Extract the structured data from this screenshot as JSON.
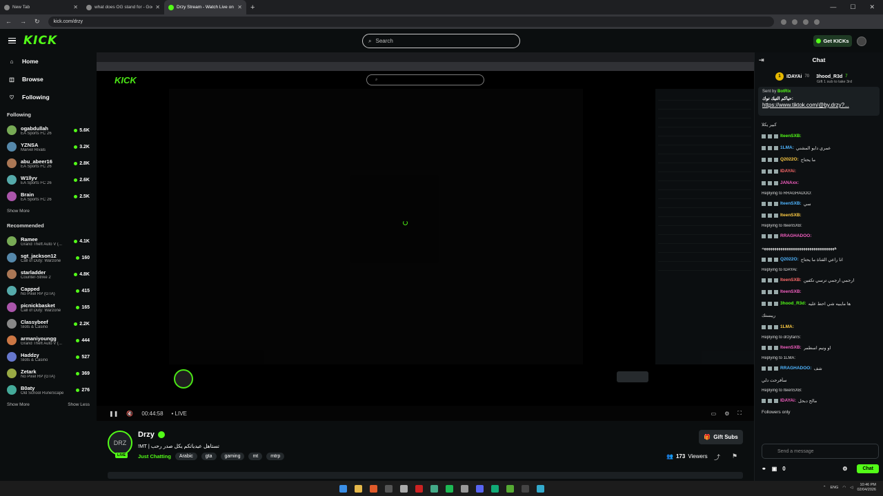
{
  "tabs": [
    {
      "title": "New Tab",
      "active": false
    },
    {
      "title": "what does OG stand for - Goog",
      "active": false
    },
    {
      "title": "Drzy Stream - Watch Live on Ki",
      "active": true
    }
  ],
  "address": {
    "url": "kick.com/drzy"
  },
  "header": {
    "logo": "KICK",
    "search_placeholder": "Search",
    "get_kicks": "Get KICKs"
  },
  "sidebar": {
    "nav": [
      {
        "label": "Home",
        "icon": "home-icon"
      },
      {
        "label": "Browse",
        "icon": "browse-icon"
      },
      {
        "label": "Following",
        "icon": "heart-icon"
      }
    ],
    "following_title": "Following",
    "following": [
      {
        "name": "ogabdullah",
        "game": "EA Sports FC 26",
        "viewers": "5.6K"
      },
      {
        "name": "YZNSA",
        "game": "Marvel Rivals",
        "viewers": "3.2K"
      },
      {
        "name": "abu_abeer16",
        "game": "EA Sports FC 26",
        "viewers": "2.8K"
      },
      {
        "name": "W1llyv",
        "game": "EA Sports FC 26",
        "viewers": "2.6K"
      },
      {
        "name": "Brain",
        "game": "EA Sports FC 26",
        "viewers": "2.5K"
      }
    ],
    "show_more_1": "Show More",
    "recommended_title": "Recommended",
    "recommended": [
      {
        "name": "Ramee",
        "game": "Grand Theft Auto V (...",
        "viewers": "4.1K"
      },
      {
        "name": "sgt_jackson12",
        "game": "Call of Duty: Warzone",
        "viewers": "160"
      },
      {
        "name": "starladder",
        "game": "Counter-Strike 2",
        "viewers": "4.8K"
      },
      {
        "name": "Capped",
        "game": "No Pixel RP (GTA)",
        "viewers": "415"
      },
      {
        "name": "picnickbasket",
        "game": "Call of Duty: Warzone",
        "viewers": "165"
      },
      {
        "name": "Classybeef",
        "game": "Slots & Casino",
        "viewers": "2.2K"
      },
      {
        "name": "armaniyoungg",
        "game": "Grand Theft Auto V (...",
        "viewers": "444"
      },
      {
        "name": "Haddzy",
        "game": "Slots & Casino",
        "viewers": "527"
      },
      {
        "name": "Zetark",
        "game": "No Pixel RP (GTA)",
        "viewers": "369"
      },
      {
        "name": "B0aty",
        "game": "Old School RuneScape",
        "viewers": "276"
      }
    ],
    "show_more_2": "Show More",
    "show_less": "Show Less"
  },
  "player": {
    "time": "00:44:58",
    "live": "LIVE"
  },
  "stream": {
    "name": "Drzy",
    "avatar_text": "DRZ",
    "live_badge": "LIVE",
    "title": "!MT | تستاهل عيدياتكم يكل صدر رحب",
    "category": "Just Chatting",
    "tags": [
      "Arabic",
      "gta",
      "gaming",
      "mt",
      "mtrp"
    ],
    "gift_subs": "Gift Subs",
    "viewers": "173",
    "viewers_label": "Viewers"
  },
  "chat": {
    "title": "Chat",
    "gifter": {
      "rank": "1",
      "name1": "IDAYAi",
      "count1": "70",
      "name2": "3hood_R3d",
      "count2": "7",
      "sub": "Gift 1 sub to take 3rd"
    },
    "pinned": {
      "sent_by": "Sent by",
      "bot": "BotRix",
      "msg": "حياكم التيك توك:",
      "link": "https://www.tiktok.com/@by.drzy?..."
    },
    "messages": [
      {
        "type": "msg",
        "user": "",
        "text": "كبير يكلا"
      },
      {
        "type": "msg",
        "user": "IteenSXB:",
        "text": ""
      },
      {
        "type": "msg",
        "user": "1LMA:",
        "text": "عمري دايو المشني"
      },
      {
        "type": "msg",
        "user": "Q2022O:",
        "text": "ما يحتاج"
      },
      {
        "type": "msg",
        "user": "IDAYAi:",
        "text": ""
      },
      {
        "type": "msg",
        "user": "JANAxx:",
        "text": ""
      },
      {
        "type": "reply",
        "user": "",
        "text": "Replying to RRAGHADOO:"
      },
      {
        "type": "msg",
        "user": "IteenSXB:",
        "text": "سي"
      },
      {
        "type": "msg",
        "user": "IteenSXB:",
        "text": ""
      },
      {
        "type": "reply",
        "user": "",
        "text": "Replying to IteenSXB:"
      },
      {
        "type": "msg",
        "user": "RRAGHADOO:",
        "text": ""
      },
      {
        "type": "msg",
        "user": "",
        "text": "هههههههههههههههههههههههههههههههههههه"
      },
      {
        "type": "msg",
        "user": "Q2022O:",
        "text": "انا راعي القناة ما يحتاج"
      },
      {
        "type": "reply",
        "user": "",
        "text": "Replying to IDAYAi:"
      },
      {
        "type": "msg",
        "user": "IteenSXB:",
        "text": "ارجمي ارجمي ترسي تكفين"
      },
      {
        "type": "msg",
        "user": "IteenSXB:",
        "text": ""
      },
      {
        "type": "msg",
        "user": "3hood_R3d:",
        "text": "ها مايبيه شي احط عليه"
      },
      {
        "type": "msg",
        "user": "",
        "text": "ريبستك"
      },
      {
        "type": "msg",
        "user": "1LMA:",
        "text": ""
      },
      {
        "type": "reply",
        "user": "",
        "text": "Replying to drzyfanS:"
      },
      {
        "type": "msg",
        "user": "IteenSXB:",
        "text": "او ونيم اسطمر"
      },
      {
        "type": "reply",
        "user": "",
        "text": "Replying to 1LMA:"
      },
      {
        "type": "msg",
        "user": "RRAGHADOO:",
        "text": "شف"
      },
      {
        "type": "msg",
        "user": "",
        "text": "سأفرحت دلي"
      },
      {
        "type": "reply",
        "user": "",
        "text": "Replying to IteenSXB:"
      },
      {
        "type": "msg",
        "user": "IDAYAi:",
        "text": "مالح دبحل"
      },
      {
        "type": "msg",
        "user": "",
        "text": "Followers only"
      }
    ],
    "input_placeholder": "Send a message",
    "points": "0",
    "chat_button": "Chat"
  },
  "taskbar": {
    "lang": "ENG",
    "time": "10:46 PM",
    "date": "02/04/2026"
  }
}
